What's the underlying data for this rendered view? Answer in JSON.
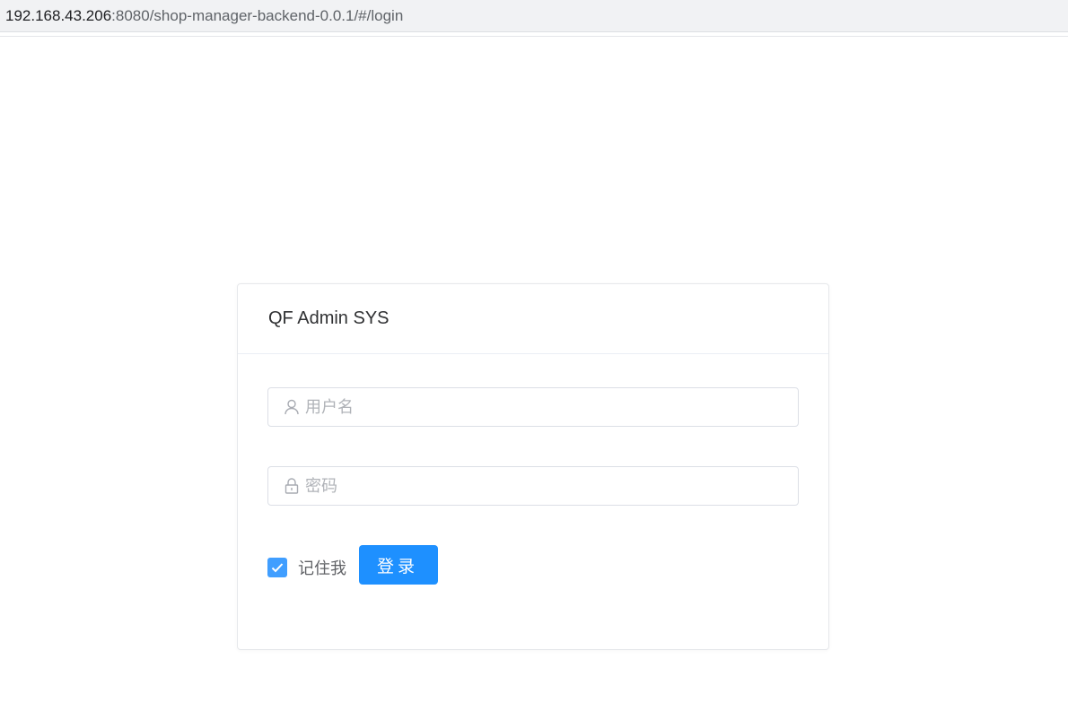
{
  "browser": {
    "url_host": "192.168.43.206",
    "url_rest": ":8080/shop-manager-backend-0.0.1/#/login"
  },
  "login_card": {
    "title": "QF Admin SYS",
    "username": {
      "placeholder": "用户名",
      "value": "",
      "icon": "user-icon"
    },
    "password": {
      "placeholder": "密码",
      "value": "",
      "icon": "lock-icon"
    },
    "remember_me": {
      "label": "记住我",
      "checked": true
    },
    "login_button": "登录"
  },
  "colors": {
    "accent": "#1e90ff",
    "checkbox": "#409eff",
    "border": "#dcdfe6"
  }
}
